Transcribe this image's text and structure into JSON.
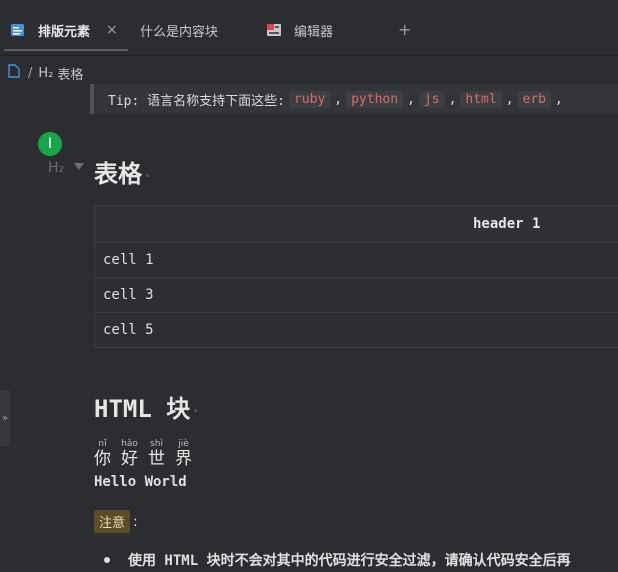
{
  "tabs": [
    {
      "label": "排版元素",
      "icon": "document-icon",
      "active": true,
      "close": "×"
    },
    {
      "label": "什么是内容块",
      "icon": "",
      "active": false
    },
    {
      "label": "编辑器",
      "icon": "board-icon",
      "active": false
    }
  ],
  "add_tab": "+",
  "breadcrumb": {
    "separator": "/",
    "heading_level": "H₂",
    "title": "表格"
  },
  "tip": {
    "prefix": "Tip: 语言名称支持下面这些:",
    "languages": [
      "ruby",
      "python",
      "js",
      "html",
      "erb"
    ],
    "sep": ","
  },
  "cursor": "I",
  "heading_marker": "H₂",
  "sections": {
    "table_heading": "表格",
    "table": {
      "header": "header 1",
      "rows": [
        "cell 1",
        "cell 3",
        "cell 5"
      ]
    },
    "html_heading": "HTML 块",
    "ruby": [
      {
        "char": "你",
        "pinyin": "nǐ"
      },
      {
        "char": "好",
        "pinyin": "hǎo"
      },
      {
        "char": "世",
        "pinyin": "shì"
      },
      {
        "char": "界",
        "pinyin": "jiè"
      }
    ],
    "hello": "Hello World",
    "note_tag": "注意",
    "note_colon": ":",
    "bullet": "使用 HTML 块时不会对其中的代码进行安全过滤，请确认代码安全后再"
  },
  "dot": "·",
  "side_expander": "»",
  "colors": {
    "accent_green": "#19a44a",
    "code_red": "#d46c6c",
    "note_bg": "#5a4d27"
  }
}
